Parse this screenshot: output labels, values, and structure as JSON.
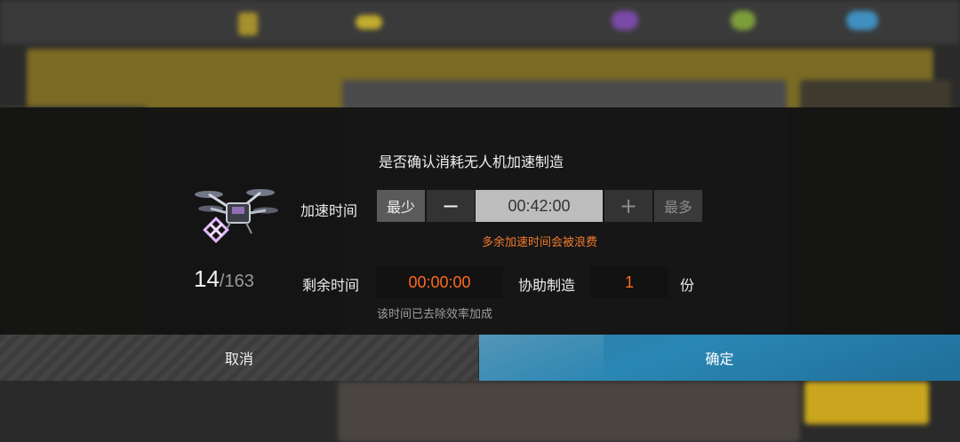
{
  "dialog": {
    "title": "是否确认消耗无人机加速制造",
    "drone_count": "14",
    "drone_total": "/163",
    "speed_label": "加速时间",
    "min_label": "最少",
    "minus_symbol": "−",
    "speed_time": "00:42:00",
    "plus_symbol": "+",
    "max_label": "最多",
    "warning": "多余加速时间会被浪费",
    "remain_label": "剩余时间",
    "remain_time": "00:00:00",
    "assist_label": "协助制造",
    "assist_count": "1",
    "unit_label": "份",
    "note": "该时间已去除效率加成"
  },
  "actions": {
    "cancel_label": "取消",
    "confirm_label": "确定"
  },
  "colors": {
    "accent_orange": "#ff6a1f",
    "confirm_blue": "#2a86b3"
  }
}
